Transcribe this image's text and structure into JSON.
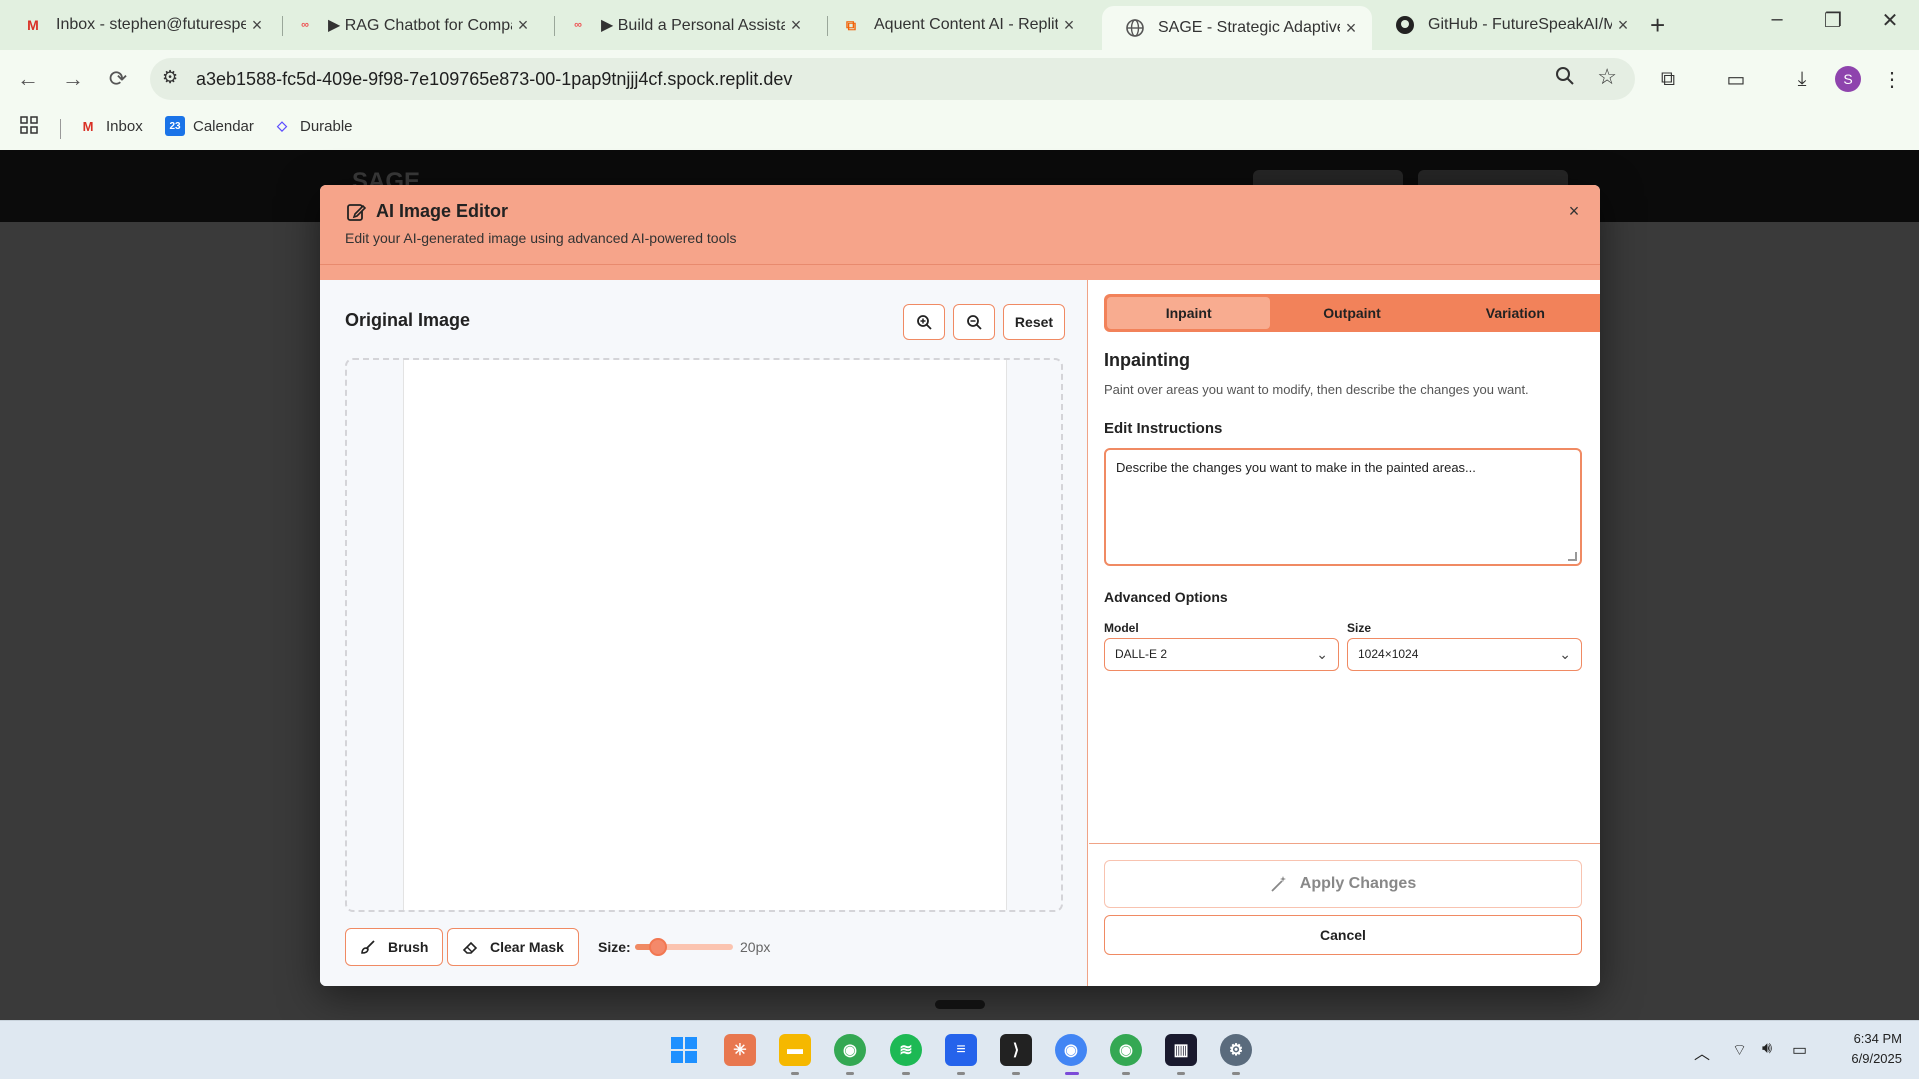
{
  "browser": {
    "tabs": [
      {
        "title": "Inbox - stephen@futurespe",
        "icon": "gmail-icon"
      },
      {
        "title": "▶ RAG Chatbot for Compar",
        "icon": "flow-icon"
      },
      {
        "title": "▶ Build a Personal Assistant",
        "icon": "flow-icon"
      },
      {
        "title": "Aquent Content AI - Replit",
        "icon": "replit-icon"
      },
      {
        "title": "SAGE - Strategic Adaptive G",
        "icon": "globe-icon"
      },
      {
        "title": "GitHub - FutureSpeakAI/My",
        "icon": "github-icon"
      }
    ],
    "url": "a3eb1588-fc5d-409e-9f98-7e109765e873-00-1pap9tnjjj4cf.spock.replit.dev",
    "profile_initial": "S",
    "bookmarks": [
      {
        "label": "Inbox",
        "icon": "gmail-icon"
      },
      {
        "label": "Calendar",
        "icon": "calendar-icon"
      },
      {
        "label": "Durable",
        "icon": "durable-icon"
      }
    ],
    "calendar_day": "23"
  },
  "app": {
    "logo": "SAGE"
  },
  "modal": {
    "title": "AI Image Editor",
    "subtitle": "Edit your AI-generated image using advanced AI-powered tools",
    "close_icon": "×",
    "left": {
      "title": "Original Image",
      "reset_label": "Reset",
      "brush_label": "Brush",
      "clear_mask_label": "Clear Mask",
      "size_label": "Size:",
      "size_value": "20px",
      "brush_size_fraction": 0.23
    },
    "right": {
      "tabs": [
        {
          "label": "Inpaint",
          "active": true
        },
        {
          "label": "Outpaint",
          "active": false
        },
        {
          "label": "Variation",
          "active": false
        }
      ],
      "section_title": "Inpainting",
      "section_desc": "Paint over areas you want to modify, then describe the changes you want.",
      "instructions_label": "Edit Instructions",
      "instructions_placeholder": "Describe the changes you want to make in the painted areas...",
      "advanced_title": "Advanced Options",
      "model_label": "Model",
      "model_value": "DALL-E 2",
      "size_label": "Size",
      "size_value": "1024×1024",
      "apply_label": "Apply Changes",
      "cancel_label": "Cancel"
    }
  },
  "taskbar": {
    "time": "6:34 PM",
    "date": "6/9/2025"
  },
  "colors": {
    "accent": "#f08a63",
    "header": "#f6a48a",
    "tab_bar": "#f2825a"
  }
}
